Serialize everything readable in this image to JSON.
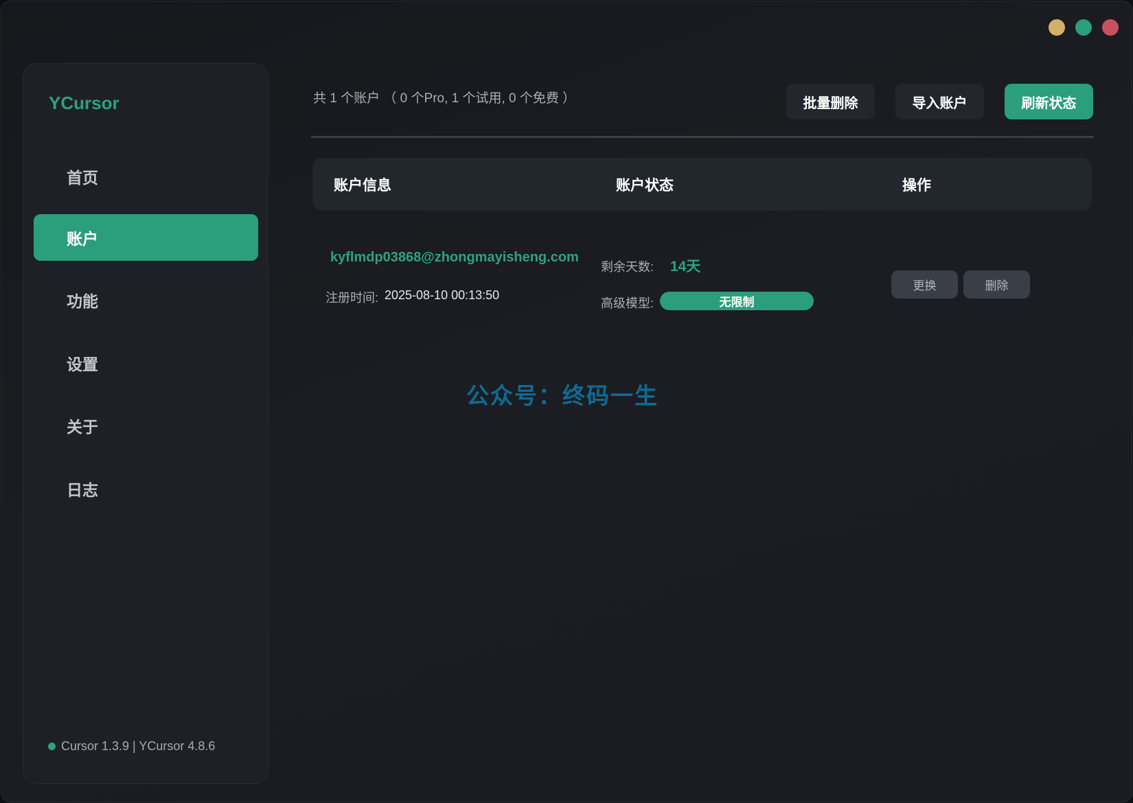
{
  "window": {
    "controls": [
      {
        "name": "minimize",
        "color": "#d4b069"
      },
      {
        "name": "maximize",
        "color": "#2b9e7c"
      },
      {
        "name": "close",
        "color": "#c9515f"
      }
    ]
  },
  "sidebar": {
    "brand": "YCursor",
    "items": [
      {
        "label": "首页",
        "active": false
      },
      {
        "label": "账户",
        "active": true
      },
      {
        "label": "功能",
        "active": false
      },
      {
        "label": "设置",
        "active": false
      },
      {
        "label": "关于",
        "active": false
      },
      {
        "label": "日志",
        "active": false
      }
    ],
    "version": "Cursor 1.3.9 | YCursor 4.8.6"
  },
  "header": {
    "summary": "共 1 个账户 （ 0 个Pro, 1 个试用, 0 个免费 ）",
    "batch_delete": "批量删除",
    "import_account": "导入账户",
    "refresh_status": "刷新状态"
  },
  "table": {
    "columns": [
      "账户信息",
      "账户状态",
      "操作"
    ],
    "rows": [
      {
        "email": "kyflmdp03868@zhongmayisheng.com",
        "registered_label": "注册时间:",
        "registered_value": "2025-08-10 00:13:50",
        "days_label": "剩余天数:",
        "days_value": "14天",
        "model_label": "高级模型:",
        "model_value": "无限制",
        "switch_label": "更换",
        "delete_label": "删除"
      }
    ]
  },
  "watermark": "公众号：终码一生",
  "colors": {
    "accent": "#2b9e7c",
    "accent_text": "#2fa27e",
    "background": "#1a1c21",
    "panel": "#1d2026",
    "watermark": "#0f6b92"
  }
}
